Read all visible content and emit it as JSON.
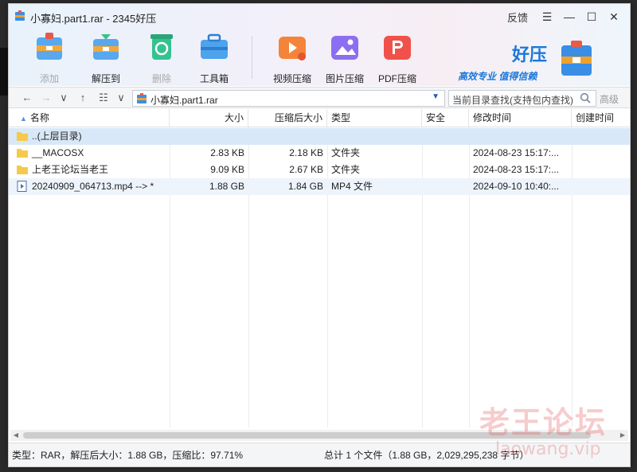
{
  "window": {
    "title": "小寡妇.part1.rar - 2345好压",
    "feedback_label": "反馈"
  },
  "toolbar": {
    "add_label": "添加",
    "extract_label": "解压到",
    "delete_label": "删除",
    "tools_label": "工具箱",
    "video_compress_label": "视频压缩",
    "image_compress_label": "图片压缩",
    "pdf_compress_label": "PDF压缩"
  },
  "brand": {
    "name": "好压",
    "slogan": "高效专业  值得信赖"
  },
  "address": {
    "path": "小寡妇.part1.rar",
    "search_placeholder": "当前目录查找(支持包内查找)",
    "advanced_label": "高级"
  },
  "columns": {
    "name": "名称",
    "size": "大小",
    "packed": "压缩后大小",
    "type": "类型",
    "security": "安全",
    "modified": "修改时间",
    "created": "创建时间"
  },
  "rows": [
    {
      "name": "..(上层目录)",
      "size": "",
      "packed": "",
      "type": "",
      "security": "",
      "modified": "",
      "created": ""
    },
    {
      "name": "__MACOSX",
      "size": "2.83 KB",
      "packed": "2.18 KB",
      "type": "文件夹",
      "security": "",
      "modified": "2024-08-23 15:17:...",
      "created": ""
    },
    {
      "name": "上老王论坛当老王",
      "size": "9.09 KB",
      "packed": "2.67 KB",
      "type": "文件夹",
      "security": "",
      "modified": "2024-08-23 15:17:...",
      "created": ""
    },
    {
      "name": "20240909_064713.mp4 --> *",
      "size": "1.88 GB",
      "packed": "1.84 GB",
      "type": "MP4 文件",
      "security": "",
      "modified": "2024-09-10 10:40:...",
      "created": ""
    }
  ],
  "status": {
    "left": "类型：RAR，解压后大小：1.88 GB，压缩比：97.71%",
    "right": "总计 1 个文件（1.88 GB，2,029,295,238 字节）"
  },
  "watermark": {
    "main": "老王论坛",
    "sub": "laowang.vip"
  },
  "colors": {
    "accent": "#1b78d9",
    "selection": "#d9e8f8"
  }
}
